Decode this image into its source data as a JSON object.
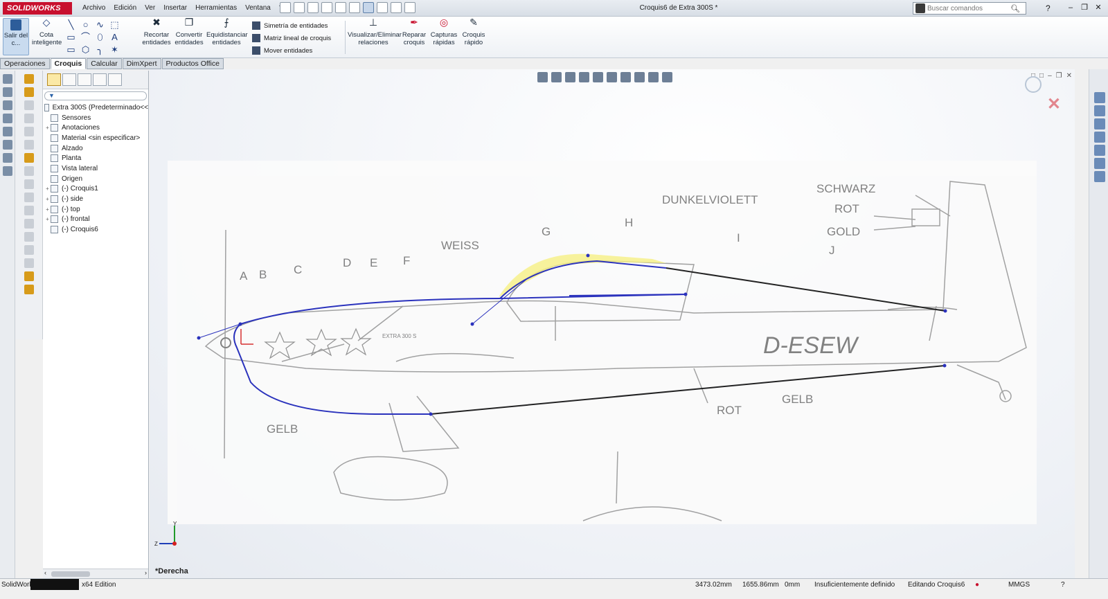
{
  "app": {
    "logo": "SOLIDWORKS",
    "title": "Croquis6 de Extra 300S *"
  },
  "menu": [
    "Archivo",
    "Edición",
    "Ver",
    "Insertar",
    "Herramientas",
    "Ventana",
    "?"
  ],
  "search": {
    "placeholder": "Buscar comandos"
  },
  "ribbon": {
    "exit_sketch": "Salir del c...",
    "smart_dim": "Cota inteligente",
    "trim": "Recortar entidades",
    "convert": "Convertir entidades",
    "offset": "Equidistanciar entidades",
    "mirror": "Simetría de entidades",
    "linear_pattern": "Matriz lineal de croquis",
    "move": "Mover entidades",
    "relations": "Visualizar/Eliminar relaciones",
    "repair": "Reparar croquis",
    "quick_snaps": "Capturas rápidas",
    "rapid_sketch": "Croquis rápido"
  },
  "command_tabs": [
    {
      "label": "Operaciones",
      "active": false
    },
    {
      "label": "Croquis",
      "active": true
    },
    {
      "label": "Calcular",
      "active": false
    },
    {
      "label": "DimXpert",
      "active": false
    },
    {
      "label": "Productos Office",
      "active": false
    }
  ],
  "tree": [
    {
      "label": "Extra 300S  (Predeterminado<<",
      "expandable": false,
      "icon": "part-icon"
    },
    {
      "label": "Sensores",
      "expandable": false,
      "icon": "sensor-icon"
    },
    {
      "label": "Anotaciones",
      "expandable": true,
      "icon": "annotation-icon"
    },
    {
      "label": "Material <sin especificar>",
      "expandable": false,
      "icon": "material-icon"
    },
    {
      "label": "Alzado",
      "expandable": false,
      "icon": "plane-icon"
    },
    {
      "label": "Planta",
      "expandable": false,
      "icon": "plane-icon"
    },
    {
      "label": "Vista lateral",
      "expandable": false,
      "icon": "plane-icon"
    },
    {
      "label": "Origen",
      "expandable": false,
      "icon": "origin-icon"
    },
    {
      "label": "(-) Croquis1",
      "expandable": true,
      "icon": "sketch-icon"
    },
    {
      "label": "(-) side",
      "expandable": true,
      "icon": "sketch-icon"
    },
    {
      "label": "(-) top",
      "expandable": true,
      "icon": "sketch-icon"
    },
    {
      "label": "(-) frontal",
      "expandable": true,
      "icon": "sketch-icon"
    },
    {
      "label": "(-) Croquis6",
      "expandable": false,
      "icon": "sketch-icon"
    }
  ],
  "drawing_labels": {
    "schwarz": "SCHWARZ",
    "rot": "ROT",
    "gold": "GOLD",
    "dunkelviolett": "DUNKELVIOLETT",
    "weiss": "WEISS",
    "gelb": "GELB",
    "gelb2": "GELB",
    "rot2": "ROT",
    "reg": "D-ESEW",
    "a": "A",
    "b": "B",
    "c": "C",
    "d": "D",
    "e": "E",
    "f": "F",
    "g": "G",
    "h": "H",
    "i": "I",
    "j": "J",
    "model": "EXTRA 300 S"
  },
  "viewport": {
    "view_name": "*Derecha",
    "triad_y": "Y",
    "triad_z": "Z"
  },
  "status": {
    "app_name": "SolidWorks",
    "edition": "x64 Edition",
    "x": "3473.02mm",
    "y": "1655.86mm",
    "z": "0mm",
    "definition": "Insuficientemente definido",
    "editing": "Editando Croquis6",
    "units": "MMGS"
  },
  "colors": {
    "accent": "#c8102e",
    "sketch_blue": "#1a22b8",
    "highlight_yellow": "#f6f07a"
  }
}
